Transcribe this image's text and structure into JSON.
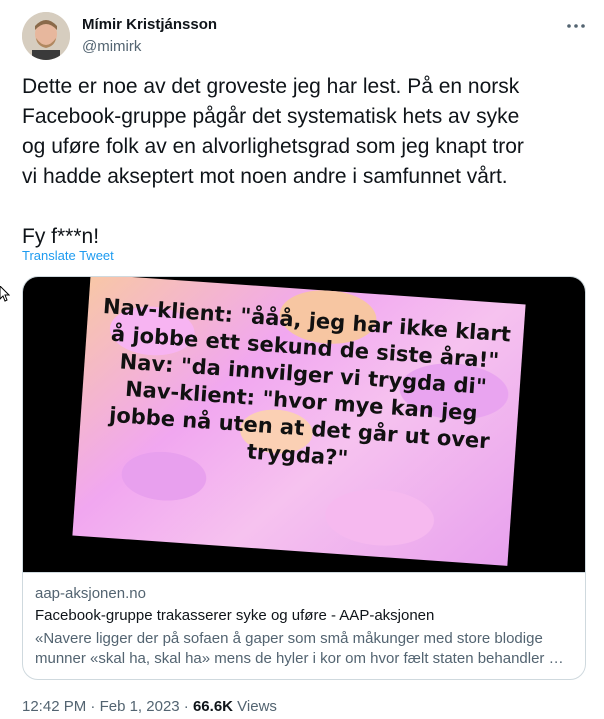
{
  "author": {
    "name": "Mímir Kristjánsson",
    "handle": "@mimirk"
  },
  "tweet": {
    "text": "Dette er noe av det groveste jeg har lest. På en norsk\nFacebook-gruppe pågår det systematisk hets av syke\nog uføre folk av en alvorlighetsgrad som jeg knapt tror\nvi hadde akseptert mot noen andre i samfunnet vårt.\n\nFy f***n!",
    "translate_label": "Translate Tweet"
  },
  "card": {
    "image_text": "Nav-klient: \"ååå, jeg har ikke klart å jobbe ett sekund de siste åra!\"\nNav: \"da innvilger vi trygda di\"\nNav-klient: \"hvor mye kan jeg jobbe nå uten at det går ut over trygda?\"",
    "domain": "aap-aksjonen.no",
    "title": "Facebook-gruppe trakasserer syke og uføre - AAP-aksjonen",
    "description": "«Navere ligger der på sofaen å gaper som små måkunger med store blodige munner «skal ha, skal ha» mens de hyler i kor om hvor fælt staten behandler …"
  },
  "meta": {
    "time": "12:42 PM",
    "separator": " · ",
    "date": "Feb 1, 2023",
    "views_count": "66.6K",
    "views_label": " Views"
  },
  "icons": {
    "more": "more-horizontal-icon",
    "cursor": "mouse-cursor-icon"
  }
}
